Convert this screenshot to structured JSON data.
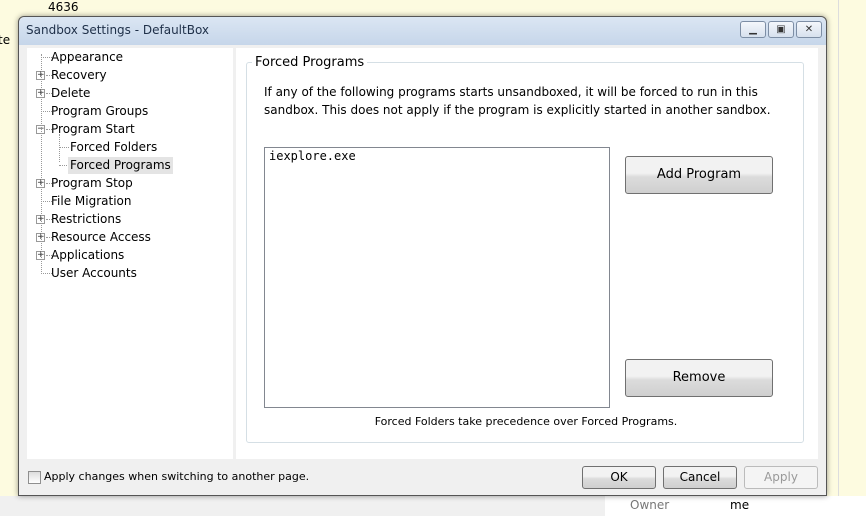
{
  "background": {
    "top_text": "4636",
    "left_fragment": "te",
    "owner_label": "Owner",
    "owner_value": "me"
  },
  "window": {
    "title": "Sandbox Settings - DefaultBox",
    "minimize": "▁",
    "maximize": "▣",
    "close": "✕"
  },
  "tree": [
    {
      "label": "Appearance",
      "level": 0,
      "expandable": false
    },
    {
      "label": "Recovery",
      "level": 0,
      "expandable": true
    },
    {
      "label": "Delete",
      "level": 0,
      "expandable": true
    },
    {
      "label": "Program Groups",
      "level": 0,
      "expandable": false
    },
    {
      "label": "Program Start",
      "level": 0,
      "expandable": true,
      "expanded": true
    },
    {
      "label": "Forced Folders",
      "level": 1,
      "expandable": false
    },
    {
      "label": "Forced Programs",
      "level": 1,
      "expandable": false,
      "selected": true
    },
    {
      "label": "Program Stop",
      "level": 0,
      "expandable": true
    },
    {
      "label": "File Migration",
      "level": 0,
      "expandable": false
    },
    {
      "label": "Restrictions",
      "level": 0,
      "expandable": true
    },
    {
      "label": "Resource Access",
      "level": 0,
      "expandable": true
    },
    {
      "label": "Applications",
      "level": 0,
      "expandable": true
    },
    {
      "label": "User Accounts",
      "level": 0,
      "expandable": false
    }
  ],
  "page": {
    "group_title": "Forced Programs",
    "description": "If any of the following programs starts unsandboxed, it will be forced to run in this sandbox.  This does not apply if the program is explicitly started in another sandbox.",
    "programs": [
      "iexplore.exe"
    ],
    "add_label": "Add Program",
    "remove_label": "Remove",
    "note": "Forced Folders take precedence over Forced Programs."
  },
  "footer": {
    "checkbox_label": "Apply changes when switching to another page.",
    "checkbox_checked": false,
    "ok": "OK",
    "cancel": "Cancel",
    "apply": "Apply",
    "apply_enabled": false
  }
}
